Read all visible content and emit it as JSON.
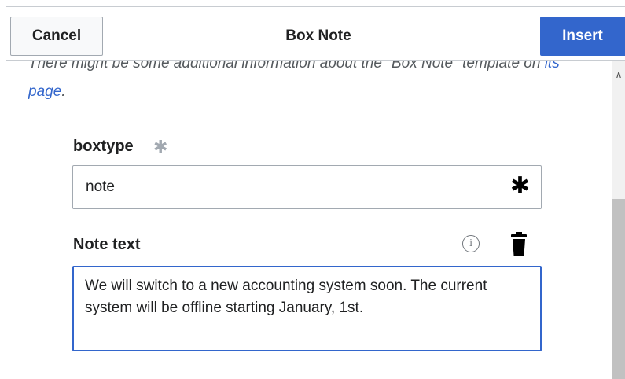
{
  "header": {
    "cancel_label": "Cancel",
    "title": "Box Note",
    "insert_label": "Insert"
  },
  "template_info": {
    "text_before_link": "There might be some additional information about the \"Box Note\" template on ",
    "link_text": "its page",
    "text_after_link": "."
  },
  "fields": {
    "boxtype": {
      "label": "boxtype",
      "required_marker": "✱",
      "value": "note",
      "input_marker": "✱"
    },
    "note_text": {
      "label": "Note text",
      "info_icon": "i",
      "value": "We will switch to a new accounting system soon. The current system will be offline starting January, 1st."
    }
  },
  "icons": {
    "info": "info-circle-icon",
    "delete": "trash-icon",
    "scroll_up": "chevron-up-icon"
  },
  "colors": {
    "primary": "#3366cc",
    "border": "#a2a9b1",
    "text": "#202122",
    "muted": "#54595d"
  }
}
